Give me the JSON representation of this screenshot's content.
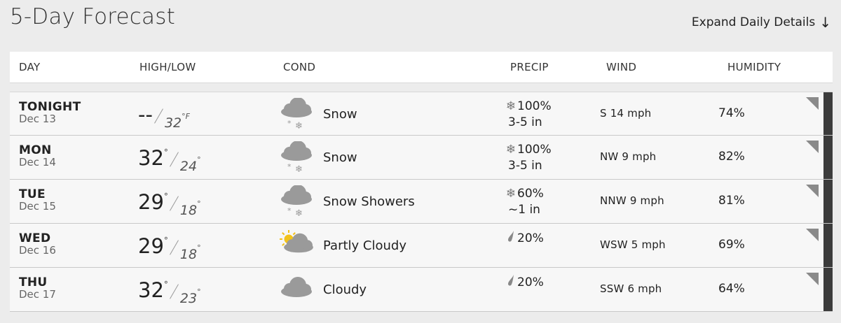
{
  "title": "5-Day Forecast",
  "expand": {
    "label": "Expand Daily Details",
    "arrow": "↓"
  },
  "columns": {
    "day": "DAY",
    "highlow": "HIGH/LOW",
    "cond": "COND",
    "precip": "PRECIP",
    "wind": "WIND",
    "humidity": "HUMIDITY"
  },
  "days": [
    {
      "name": "TONIGHT",
      "date": "Dec 13",
      "high": "--",
      "high_deg": "",
      "low": "32",
      "low_deg": "°F",
      "icon": "snow-icon",
      "cond": "Snow",
      "precip_icon": "snowflake-icon",
      "precip_glyph": "❄",
      "precip": "100%",
      "precip_amt": "3-5 in",
      "wind": "S 14 mph",
      "humidity": "74%"
    },
    {
      "name": "MON",
      "date": "Dec 14",
      "high": "32",
      "high_deg": "°",
      "low": "24",
      "low_deg": "°",
      "icon": "snow-icon",
      "cond": "Snow",
      "precip_icon": "snowflake-icon",
      "precip_glyph": "❄",
      "precip": "100%",
      "precip_amt": "3-5 in",
      "wind": "NW 9 mph",
      "humidity": "82%"
    },
    {
      "name": "TUE",
      "date": "Dec 15",
      "high": "29",
      "high_deg": "°",
      "low": "18",
      "low_deg": "°",
      "icon": "snow-icon",
      "cond": "Snow Showers",
      "precip_icon": "snowflake-icon",
      "precip_glyph": "❄",
      "precip": "60%",
      "precip_amt": "~1 in",
      "wind": "NNW 9 mph",
      "humidity": "81%"
    },
    {
      "name": "WED",
      "date": "Dec 16",
      "high": "29",
      "high_deg": "°",
      "low": "18",
      "low_deg": "°",
      "icon": "partly-cloudy-icon",
      "cond": "Partly Cloudy",
      "precip_icon": "raindrop-icon",
      "precip_glyph": "",
      "precip": "20%",
      "precip_amt": "",
      "wind": "WSW 5 mph",
      "humidity": "69%"
    },
    {
      "name": "THU",
      "date": "Dec 17",
      "high": "32",
      "high_deg": "°",
      "low": "23",
      "low_deg": "°",
      "icon": "cloudy-icon",
      "cond": "Cloudy",
      "precip_icon": "raindrop-icon",
      "precip_glyph": "",
      "precip": "20%",
      "precip_amt": "",
      "wind": "SSW 6 mph",
      "humidity": "64%"
    }
  ],
  "colors": {
    "background": "#ececec",
    "row": "#f7f7f7",
    "edge": "#3c3c3c",
    "icon": "#9a9a9a",
    "sun": "#f2c21a"
  }
}
